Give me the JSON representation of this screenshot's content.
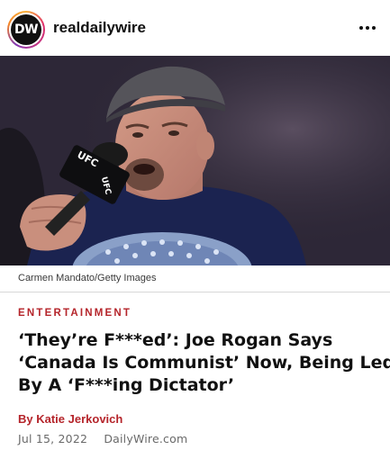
{
  "account": {
    "avatar_text": "DW",
    "username": "realdailywire",
    "more_icon": "more-horizontal-icon"
  },
  "photo": {
    "caption": "Carmen Mandato/Getty Images",
    "mic_label_1": "UFC",
    "mic_label_2": "UFC"
  },
  "article": {
    "section": "ENTERTAINMENT",
    "headline_lines": [
      "‘They’re F***ed’: Joe Rogan Says",
      "‘Canada Is Communist’ Now, Being Led",
      "By A ‘F***ing Dictator’"
    ],
    "byline": "By Katie Jerkovich",
    "date": "Jul 15, 2022",
    "source": "DailyWire.com"
  },
  "colors": {
    "accent": "#b5252b",
    "shirt": "#1b2350",
    "background_dark": "#2a2533"
  }
}
